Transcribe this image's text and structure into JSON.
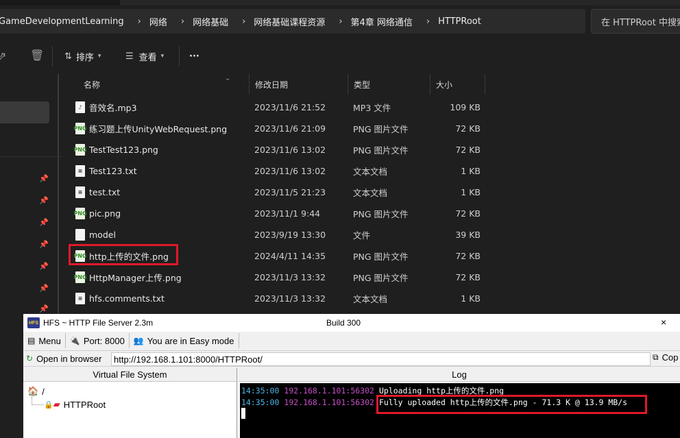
{
  "breadcrumbs": [
    "GameDevelopmentLearning",
    "网络",
    "网络基础",
    "网络基础课程资源",
    "第4章 网络通信",
    "HTTPRoot"
  ],
  "search": {
    "placeholder": "在 HTTPRoot 中搜索"
  },
  "toolbar": {
    "sort_label": "排序",
    "view_label": "查看",
    "more_label": "···"
  },
  "columns": {
    "name": "名称",
    "modified": "修改日期",
    "type": "类型",
    "size": "大小"
  },
  "files": [
    {
      "name": "音效名.mp3",
      "icon": "mp3-file-icon",
      "modified": "2023/11/6 21:52",
      "type": "MP3 文件",
      "size": "109 KB"
    },
    {
      "name": "练习题上传UnityWebRequest.png",
      "icon": "png-file-icon",
      "modified": "2023/11/6 21:09",
      "type": "PNG 图片文件",
      "size": "72 KB"
    },
    {
      "name": "TestTest123.png",
      "icon": "png-file-icon",
      "modified": "2023/11/6 13:02",
      "type": "PNG 图片文件",
      "size": "72 KB"
    },
    {
      "name": "Test123.txt",
      "icon": "text-file-icon",
      "modified": "2023/11/6 13:02",
      "type": "文本文档",
      "size": "1 KB"
    },
    {
      "name": "test.txt",
      "icon": "text-file-icon",
      "modified": "2023/11/5 21:23",
      "type": "文本文档",
      "size": "1 KB"
    },
    {
      "name": "pic.png",
      "icon": "png-file-icon",
      "modified": "2023/11/1 9:44",
      "type": "PNG 图片文件",
      "size": "72 KB"
    },
    {
      "name": "model",
      "icon": "generic-file-icon",
      "modified": "2023/9/19 13:30",
      "type": "文件",
      "size": "39 KB"
    },
    {
      "name": "http上传的文件.png",
      "icon": "png-file-icon",
      "modified": "2024/4/11 14:35",
      "type": "PNG 图片文件",
      "size": "72 KB"
    },
    {
      "name": "HttpManager上传.png",
      "icon": "png-file-icon",
      "modified": "2023/11/3 13:32",
      "type": "PNG 图片文件",
      "size": "72 KB"
    },
    {
      "name": "hfs.comments.txt",
      "icon": "text-file-icon",
      "modified": "2023/11/3 13:32",
      "type": "文本文档",
      "size": "1 KB"
    }
  ],
  "hfs": {
    "title": "HFS ~ HTTP File Server 2.3m",
    "build": "Build 300",
    "logo_text": "HFS",
    "close_glyph": "×",
    "menu_label": "Menu",
    "port_label": "Port: 8000",
    "mode_label": "You are in Easy mode",
    "open_browser_label": "Open in browser",
    "url": "http://192.168.1.101:8000/HTTPRoot/",
    "copy_label": "Cop",
    "vfs_header": "Virtual File System",
    "vfs_root": "/",
    "vfs_folder": "HTTPRoot",
    "log_header": "Log",
    "log": [
      {
        "time": "14:35:00",
        "ip": "192.168.1.101:56302",
        "message": "Uploading http上传的文件.png"
      },
      {
        "time": "14:35:00",
        "ip": "192.168.1.101:56302",
        "message": "Fully uploaded http上传的文件.png - 71.3 K @ 13.9 MB/s"
      }
    ]
  },
  "colors": {
    "highlight_box": "#e0192a",
    "log_time": "#4fb6e8",
    "log_ip": "#c84ec8"
  }
}
